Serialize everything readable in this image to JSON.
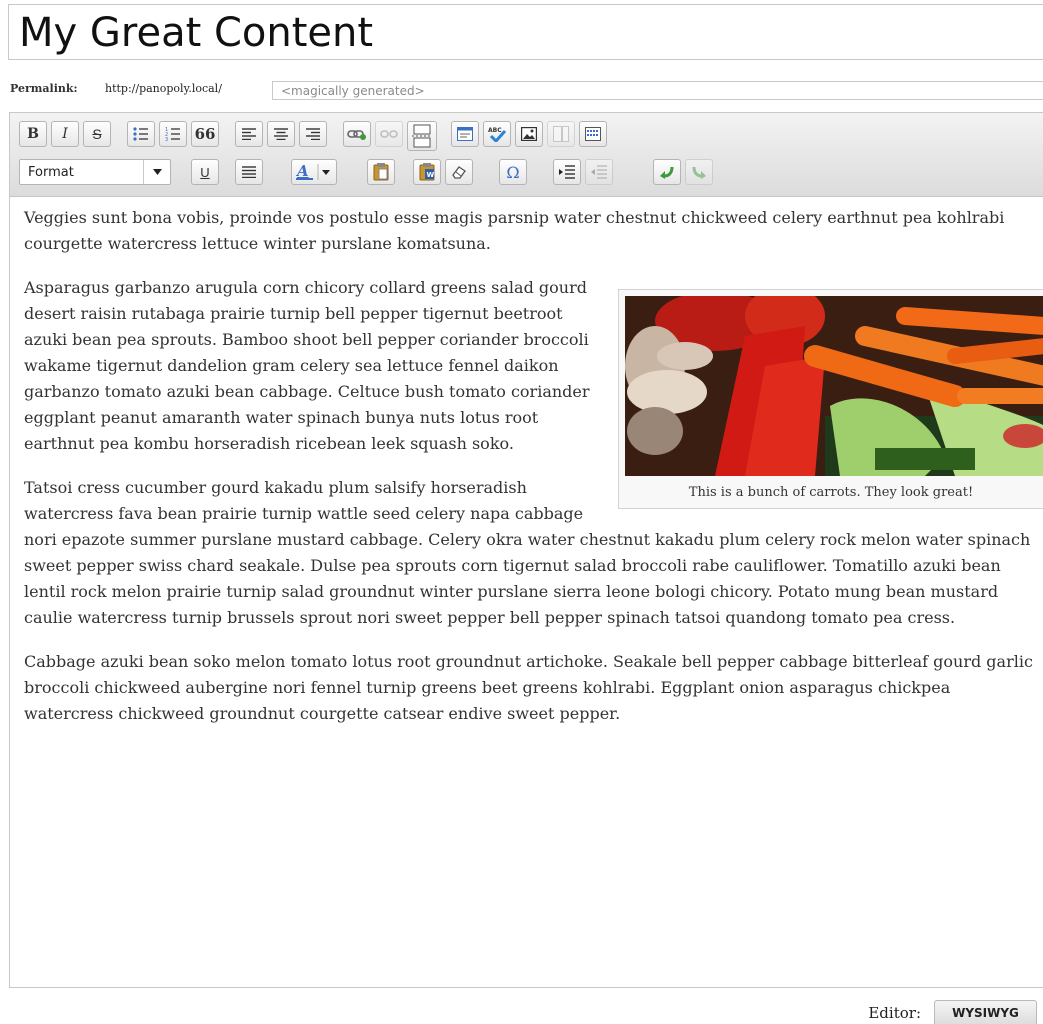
{
  "title": {
    "value": "My Great Content"
  },
  "permalink": {
    "label": "Permalink:",
    "base_url": "http://panopoly.local/",
    "slug_placeholder": "<magically generated>"
  },
  "toolbar": {
    "row1": [
      "bold-icon",
      "italic-icon",
      "strikethrough-icon",
      "bulleted-list-icon",
      "numbered-list-icon",
      "blockquote-icon",
      "align-left-icon",
      "align-center-icon",
      "align-right-icon",
      "link-icon",
      "unlink-icon",
      "page-break-icon",
      "paste-text-icon",
      "spellcheck-icon",
      "insert-image-icon",
      "template-icon",
      "table-icon"
    ],
    "format_select": {
      "value": "Format"
    },
    "row2_icons": [
      "underline-icon",
      "justify-icon",
      "font-color-icon",
      "paste-icon",
      "paste-word-icon",
      "remove-format-icon",
      "special-char-icon",
      "indent-icon",
      "outdent-icon",
      "undo-icon",
      "redo-icon"
    ],
    "underline_glyph": "U",
    "special_char_glyph": "Ω",
    "bold_glyph": "B",
    "italic_glyph": "I",
    "strike_glyph": "S",
    "quote_glyph": "66"
  },
  "body": {
    "paragraphs": [
      "Veggies sunt bona vobis, proinde vos postulo esse magis parsnip water chestnut chickweed celery earthnut pea kohlrabi courgette watercress lettuce winter purslane komatsuna.",
      "Asparagus garbanzo arugula corn chicory collard greens salad gourd desert raisin rutabaga prairie turnip bell pepper tigernut beetroot azuki bean pea sprouts. Bamboo shoot bell pepper coriander broccoli wakame tigernut dandelion gram celery sea lettuce fennel daikon garbanzo tomato azuki bean cabbage. Celtuce bush tomato coriander eggplant peanut amaranth water spinach bunya nuts lotus root earthnut pea kombu horseradish ricebean leek squash soko.",
      "Tatsoi cress cucumber gourd kakadu plum salsify horseradish watercress fava bean prairie turnip wattle seed celery napa cabbage nori epazote summer purslane mustard cabbage. Celery okra water chestnut kakadu plum celery rock melon water spinach sweet pepper swiss chard seakale. Dulse pea sprouts corn tigernut salad broccoli rabe cauliflower. Tomatillo azuki bean lentil rock melon prairie turnip salad groundnut winter purslane sierra leone bologi chicory. Potato mung bean mustard caulie watercress turnip brussels sprout nori sweet pepper bell pepper spinach tatsoi quandong tomato pea cress.",
      "Cabbage azuki bean soko melon tomato lotus root groundnut artichoke. Seakale bell pepper cabbage bitterleaf gourd garlic broccoli chickweed aubergine nori fennel turnip greens beet greens kohlrabi. Eggplant onion asparagus chickpea watercress chickweed groundnut courgette catsear endive sweet pepper."
    ],
    "figure_caption": "This is a bunch of carrots. They look great!"
  },
  "editor_switch": {
    "label": "Editor:",
    "active_tab": "WYSIWYG"
  }
}
